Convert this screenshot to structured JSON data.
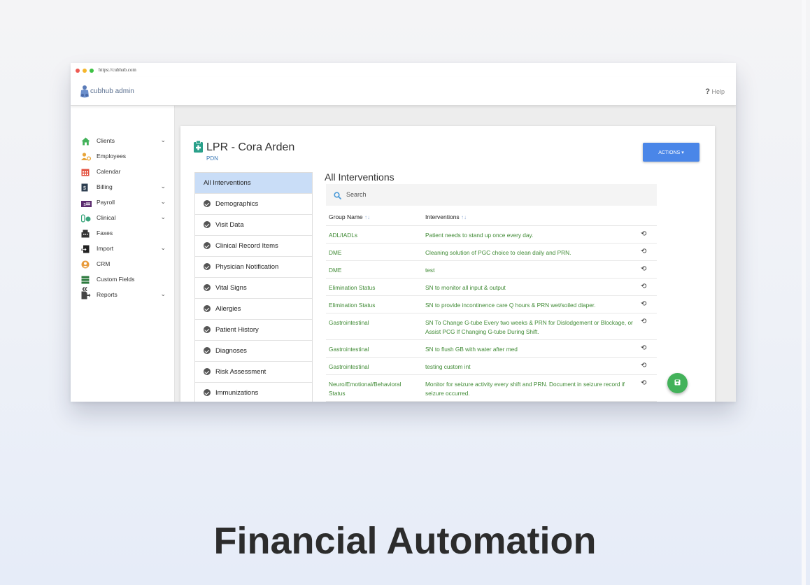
{
  "browser": {
    "url": "https://cubhub.com",
    "dot_colors": [
      "#ee5a52",
      "#f5b62c",
      "#3dc144"
    ]
  },
  "app": {
    "logo_text": "cubhub admin",
    "help_label": "Help"
  },
  "sidebar": {
    "items": [
      {
        "label": "Clients",
        "icon": "home-icon",
        "color": "#43b25a",
        "has_chevron": true
      },
      {
        "label": "Employees",
        "icon": "employees-icon",
        "color": "#e8a53a",
        "has_chevron": false
      },
      {
        "label": "Calendar",
        "icon": "calendar-icon",
        "color": "#e3503e",
        "has_chevron": false
      },
      {
        "label": "Billing",
        "icon": "billing-icon",
        "color": "#2d3e50",
        "has_chevron": true
      },
      {
        "label": "Payroll",
        "icon": "payroll-icon",
        "color": "#5b2b6e",
        "has_chevron": true
      },
      {
        "label": "Clinical",
        "icon": "clinical-icon",
        "color": "#3aa57c",
        "has_chevron": true
      },
      {
        "label": "Faxes",
        "icon": "fax-icon",
        "color": "#333333",
        "has_chevron": false
      },
      {
        "label": "Import",
        "icon": "import-icon",
        "color": "#222222",
        "has_chevron": true
      },
      {
        "label": "CRM",
        "icon": "crm-icon",
        "color": "#e89a3a",
        "has_chevron": false
      },
      {
        "label": "Custom Fields",
        "icon": "custom-fields-icon",
        "color": "#2c7a3e",
        "has_chevron": false
      },
      {
        "label": "Reports",
        "icon": "reports-icon",
        "color": "#444444",
        "has_chevron": true
      }
    ],
    "collapse_glyph": "«"
  },
  "card": {
    "title": "LPR - Cora Arden",
    "subtitle": "PDN",
    "actions_label": "ACTIONS ▾",
    "accent": "#4a86e8",
    "tabs": [
      {
        "label": "All Interventions",
        "active": true
      },
      {
        "label": "Demographics",
        "active": false
      },
      {
        "label": "Visit Data",
        "active": false
      },
      {
        "label": "Clinical Record Items",
        "active": false
      },
      {
        "label": "Physician Notification",
        "active": false
      },
      {
        "label": "Vital Signs",
        "active": false
      },
      {
        "label": "Allergies",
        "active": false
      },
      {
        "label": "Patient History",
        "active": false
      },
      {
        "label": "Diagnoses",
        "active": false
      },
      {
        "label": "Risk Assessment",
        "active": false
      },
      {
        "label": "Immunizations",
        "active": false
      }
    ],
    "section_title": "All Interventions",
    "search_placeholder": "Search",
    "columns": [
      "Group Name",
      "Interventions"
    ],
    "sort_glyph": "↑↓",
    "rows": [
      {
        "group": "ADL/IADLs",
        "intervention": "Patient needs to stand up once every day."
      },
      {
        "group": "DME",
        "intervention": "Cleaning solution of PGC choice to clean daily and PRN."
      },
      {
        "group": "DME",
        "intervention": "test"
      },
      {
        "group": "Elimination Status",
        "intervention": "SN to monitor all input & output"
      },
      {
        "group": "Elimination Status",
        "intervention": "SN to provide incontinence care Q hours & PRN wet/soiled diaper."
      },
      {
        "group": "Gastrointestinal",
        "intervention": "SN To Change G-tube Every two weeks & PRN for Dislodgement or Blockage, or Assist PCG If Changing G-tube During Shift."
      },
      {
        "group": "Gastrointestinal",
        "intervention": "SN to flush GB with water after med"
      },
      {
        "group": "Gastrointestinal",
        "intervention": "testing custom int"
      },
      {
        "group": "Neuro/Emotional/Behavioral Status",
        "intervention": "Monitor for seizure activity every shift and PRN. Document in seizure record if seizure occurred."
      }
    ],
    "history_glyph": "⟲",
    "save_fab_color": "#43b25a"
  },
  "headline": "Financial Automation"
}
